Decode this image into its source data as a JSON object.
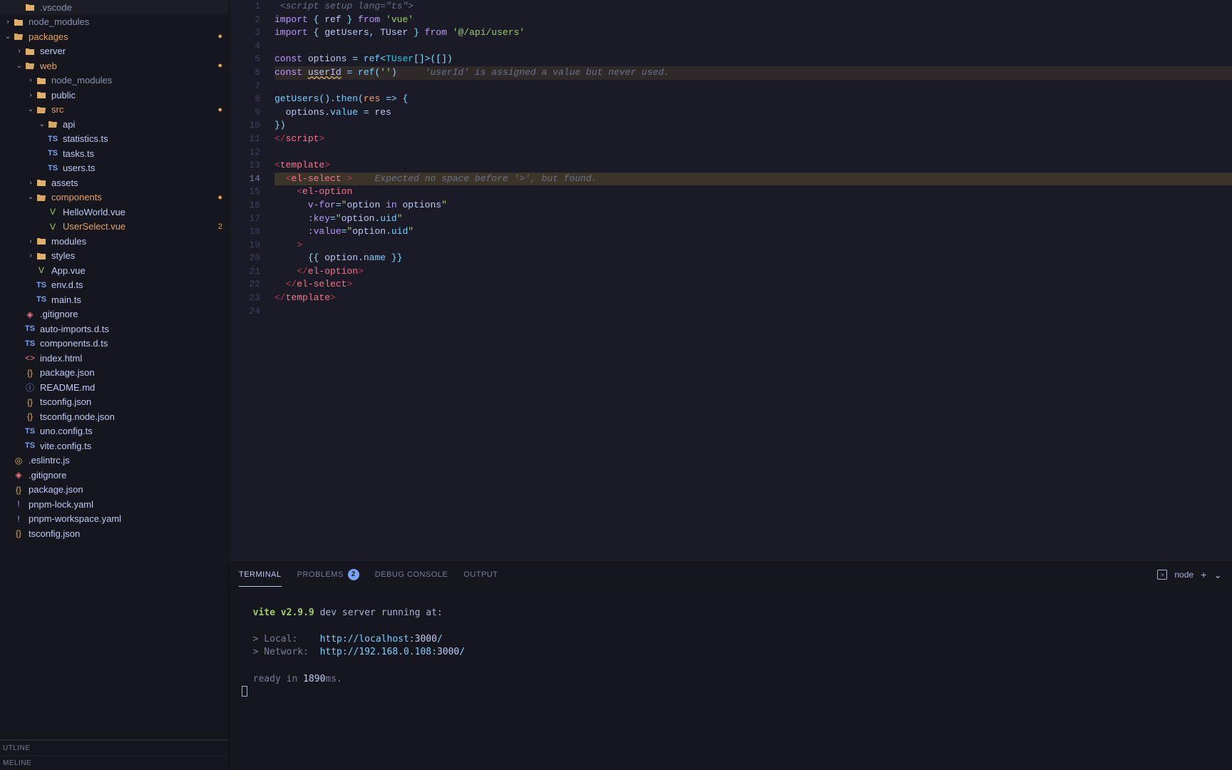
{
  "sidebar": {
    "items": [
      {
        "indent": 1,
        "twisty": "",
        "icon": "folder",
        "iconClass": "ic-folder",
        "label": ".vscode",
        "style": "dim"
      },
      {
        "indent": 0,
        "twisty": ">",
        "icon": "folder",
        "iconClass": "ic-folder",
        "label": "node_modules",
        "style": "dim"
      },
      {
        "indent": 0,
        "twisty": "v",
        "icon": "folder-open",
        "iconClass": "ic-folder-open",
        "label": "packages",
        "style": "highlight",
        "badge": "dot"
      },
      {
        "indent": 1,
        "twisty": ">",
        "icon": "folder",
        "iconClass": "ic-folder",
        "label": "server"
      },
      {
        "indent": 1,
        "twisty": "v",
        "icon": "folder-open",
        "iconClass": "ic-folder-open",
        "label": "web",
        "style": "highlight",
        "badge": "dot"
      },
      {
        "indent": 2,
        "twisty": ">",
        "icon": "folder",
        "iconClass": "ic-folder",
        "label": "node_modules",
        "style": "dim"
      },
      {
        "indent": 2,
        "twisty": ">",
        "icon": "folder",
        "iconClass": "ic-folder",
        "label": "public"
      },
      {
        "indent": 2,
        "twisty": "v",
        "icon": "folder-open",
        "iconClass": "ic-folder-open",
        "label": "src",
        "style": "highlight",
        "badge": "dot"
      },
      {
        "indent": 3,
        "twisty": "v",
        "icon": "folder-open",
        "iconClass": "ic-folder-open",
        "label": "api"
      },
      {
        "indent": 3,
        "twisty": "",
        "icon": "TS",
        "iconClass": "ic-ts",
        "label": "statistics.ts"
      },
      {
        "indent": 3,
        "twisty": "",
        "icon": "TS",
        "iconClass": "ic-ts",
        "label": "tasks.ts"
      },
      {
        "indent": 3,
        "twisty": "",
        "icon": "TS",
        "iconClass": "ic-ts",
        "label": "users.ts"
      },
      {
        "indent": 2,
        "twisty": ">",
        "icon": "folder",
        "iconClass": "ic-folder",
        "label": "assets"
      },
      {
        "indent": 2,
        "twisty": "v",
        "icon": "folder-open",
        "iconClass": "ic-folder-open",
        "label": "components",
        "style": "highlight",
        "badge": "dot"
      },
      {
        "indent": 3,
        "twisty": "",
        "icon": "V",
        "iconClass": "ic-vue",
        "label": "HelloWorld.vue"
      },
      {
        "indent": 3,
        "twisty": "",
        "icon": "V",
        "iconClass": "ic-vue",
        "label": "UserSelect.vue",
        "style": "highlight",
        "badge": "2"
      },
      {
        "indent": 2,
        "twisty": ">",
        "icon": "folder",
        "iconClass": "ic-folder",
        "label": "modules"
      },
      {
        "indent": 2,
        "twisty": ">",
        "icon": "folder",
        "iconClass": "ic-folder",
        "label": "styles"
      },
      {
        "indent": 2,
        "twisty": "",
        "icon": "V",
        "iconClass": "ic-vue",
        "label": "App.vue"
      },
      {
        "indent": 2,
        "twisty": "",
        "icon": "TS",
        "iconClass": "ic-ts",
        "label": "env.d.ts"
      },
      {
        "indent": 2,
        "twisty": "",
        "icon": "TS",
        "iconClass": "ic-ts",
        "label": "main.ts"
      },
      {
        "indent": 1,
        "twisty": "",
        "icon": "◈",
        "iconClass": "ic-git",
        "label": ".gitignore"
      },
      {
        "indent": 1,
        "twisty": "",
        "icon": "TS",
        "iconClass": "ic-ts",
        "label": "auto-imports.d.ts"
      },
      {
        "indent": 1,
        "twisty": "",
        "icon": "TS",
        "iconClass": "ic-ts",
        "label": "components.d.ts"
      },
      {
        "indent": 1,
        "twisty": "",
        "icon": "<>",
        "iconClass": "ic-html",
        "label": "index.html"
      },
      {
        "indent": 1,
        "twisty": "",
        "icon": "{}",
        "iconClass": "ic-json",
        "label": "package.json"
      },
      {
        "indent": 1,
        "twisty": "",
        "icon": "ⓘ",
        "iconClass": "ic-md",
        "label": "README.md"
      },
      {
        "indent": 1,
        "twisty": "",
        "icon": "{}",
        "iconClass": "ic-json",
        "label": "tsconfig.json"
      },
      {
        "indent": 1,
        "twisty": "",
        "icon": "{}",
        "iconClass": "ic-json",
        "label": "tsconfig.node.json"
      },
      {
        "indent": 1,
        "twisty": "",
        "icon": "TS",
        "iconClass": "ic-ts",
        "label": "uno.config.ts"
      },
      {
        "indent": 1,
        "twisty": "",
        "icon": "TS",
        "iconClass": "ic-ts",
        "label": "vite.config.ts"
      },
      {
        "indent": 0,
        "twisty": "",
        "icon": "◎",
        "iconClass": "ic-js",
        "label": ".eslintrc.js"
      },
      {
        "indent": 0,
        "twisty": "",
        "icon": "◈",
        "iconClass": "ic-git",
        "label": ".gitignore"
      },
      {
        "indent": 0,
        "twisty": "",
        "icon": "{}",
        "iconClass": "ic-json",
        "label": "package.json"
      },
      {
        "indent": 0,
        "twisty": "",
        "icon": "!",
        "iconClass": "ic-yaml",
        "label": "pnpm-lock.yaml"
      },
      {
        "indent": 0,
        "twisty": "",
        "icon": "!",
        "iconClass": "ic-yaml",
        "label": "pnpm-workspace.yaml"
      },
      {
        "indent": 0,
        "twisty": "",
        "icon": "{}",
        "iconClass": "ic-json",
        "label": "tsconfig.json"
      }
    ],
    "sections": {
      "outline": "UTLINE",
      "timeline": "MELINE"
    }
  },
  "editor": {
    "lineCount": 24,
    "activeLine": 14,
    "tokens": [
      [
        {
          "t": " ",
          "c": "punc"
        },
        {
          "t": "<script setup lang=\"ts\">",
          "c": "err"
        }
      ],
      [
        {
          "t": "import ",
          "c": "kw"
        },
        {
          "t": "{ ",
          "c": "punc"
        },
        {
          "t": "ref",
          "c": "var"
        },
        {
          "t": " } ",
          "c": "punc"
        },
        {
          "t": "from ",
          "c": "kw"
        },
        {
          "t": "'vue'",
          "c": "str"
        }
      ],
      [
        {
          "t": "import ",
          "c": "kw"
        },
        {
          "t": "{ ",
          "c": "punc"
        },
        {
          "t": "getUsers",
          "c": "var"
        },
        {
          "t": ", ",
          "c": "punc"
        },
        {
          "t": "TUser",
          "c": "var"
        },
        {
          "t": " } ",
          "c": "punc"
        },
        {
          "t": "from ",
          "c": "kw"
        },
        {
          "t": "'@/api/users'",
          "c": "str"
        }
      ],
      [],
      [
        {
          "t": "const ",
          "c": "kw"
        },
        {
          "t": "options",
          "c": "var"
        },
        {
          "t": " = ",
          "c": "op"
        },
        {
          "t": "ref",
          "c": "fn"
        },
        {
          "t": "<",
          "c": "punc"
        },
        {
          "t": "TUser",
          "c": "type"
        },
        {
          "t": "[]>",
          "c": "punc"
        },
        {
          "t": "([])",
          "c": "punc"
        }
      ],
      [
        {
          "t": "const ",
          "c": "kw"
        },
        {
          "t": "userId",
          "c": "var wavy"
        },
        {
          "t": " = ",
          "c": "op"
        },
        {
          "t": "ref",
          "c": "fn"
        },
        {
          "t": "(",
          "c": "punc"
        },
        {
          "t": "''",
          "c": "str"
        },
        {
          "t": ")",
          "c": "punc"
        },
        {
          "t": "     ",
          "c": ""
        },
        {
          "t": "'userId' is assigned a value but never used.",
          "c": "err"
        }
      ],
      [],
      [
        {
          "t": "getUsers",
          "c": "fn"
        },
        {
          "t": "()",
          "c": "punc"
        },
        {
          "t": ".",
          "c": "punc"
        },
        {
          "t": "then",
          "c": "fn"
        },
        {
          "t": "(",
          "c": "punc"
        },
        {
          "t": "res",
          "c": "num"
        },
        {
          "t": " => ",
          "c": "op"
        },
        {
          "t": "{",
          "c": "punc"
        }
      ],
      [
        {
          "t": "  options",
          "c": "var"
        },
        {
          "t": ".",
          "c": "punc"
        },
        {
          "t": "value",
          "c": "prop"
        },
        {
          "t": " = ",
          "c": "op"
        },
        {
          "t": "res",
          "c": "var"
        }
      ],
      [
        {
          "t": "})",
          "c": "punc"
        }
      ],
      [
        {
          "t": "</",
          "c": "tagb"
        },
        {
          "t": "script",
          "c": "tag"
        },
        {
          "t": ">",
          "c": "tagb"
        }
      ],
      [],
      [
        {
          "t": "<",
          "c": "tagb"
        },
        {
          "t": "template",
          "c": "tag"
        },
        {
          "t": ">",
          "c": "tagb"
        }
      ],
      [
        {
          "t": "  ",
          "c": ""
        },
        {
          "t": "<",
          "c": "tagb"
        },
        {
          "t": "el-select",
          "c": "tag"
        },
        {
          "t": " ",
          "c": ""
        },
        {
          "t": ">",
          "c": "tagb"
        },
        {
          "t": "    ",
          "c": ""
        },
        {
          "t": "Expected no space before '>', but found.",
          "c": "err"
        }
      ],
      [
        {
          "t": "    ",
          "c": ""
        },
        {
          "t": "<",
          "c": "tagb"
        },
        {
          "t": "el-option",
          "c": "tag"
        }
      ],
      [
        {
          "t": "      ",
          "c": ""
        },
        {
          "t": "v-for",
          "c": "attr"
        },
        {
          "t": "=",
          "c": "op"
        },
        {
          "t": "\"",
          "c": "str"
        },
        {
          "t": "option ",
          "c": "var"
        },
        {
          "t": "in ",
          "c": "kw"
        },
        {
          "t": "options",
          "c": "var"
        },
        {
          "t": "\"",
          "c": "str"
        }
      ],
      [
        {
          "t": "      ",
          "c": ""
        },
        {
          "t": ":key",
          "c": "attr"
        },
        {
          "t": "=",
          "c": "op"
        },
        {
          "t": "\"",
          "c": "str"
        },
        {
          "t": "option",
          "c": "var"
        },
        {
          "t": ".",
          "c": "punc"
        },
        {
          "t": "uid",
          "c": "prop"
        },
        {
          "t": "\"",
          "c": "str"
        }
      ],
      [
        {
          "t": "      ",
          "c": ""
        },
        {
          "t": ":value",
          "c": "attr"
        },
        {
          "t": "=",
          "c": "op"
        },
        {
          "t": "\"",
          "c": "str"
        },
        {
          "t": "option",
          "c": "var"
        },
        {
          "t": ".",
          "c": "punc"
        },
        {
          "t": "uid",
          "c": "prop"
        },
        {
          "t": "\"",
          "c": "str"
        }
      ],
      [
        {
          "t": "    ",
          "c": ""
        },
        {
          "t": ">",
          "c": "tagb"
        }
      ],
      [
        {
          "t": "      ",
          "c": ""
        },
        {
          "t": "{{ ",
          "c": "punc"
        },
        {
          "t": "option",
          "c": "var"
        },
        {
          "t": ".",
          "c": "punc"
        },
        {
          "t": "name",
          "c": "prop"
        },
        {
          "t": " }}",
          "c": "punc"
        }
      ],
      [
        {
          "t": "    ",
          "c": ""
        },
        {
          "t": "</",
          "c": "tagb"
        },
        {
          "t": "el-option",
          "c": "tag"
        },
        {
          "t": ">",
          "c": "tagb"
        }
      ],
      [
        {
          "t": "  ",
          "c": ""
        },
        {
          "t": "</",
          "c": "tagb"
        },
        {
          "t": "el-select",
          "c": "tag"
        },
        {
          "t": ">",
          "c": "tagb"
        }
      ],
      [
        {
          "t": "</",
          "c": "tagb"
        },
        {
          "t": "template",
          "c": "tag"
        },
        {
          "t": ">",
          "c": "tagb"
        }
      ],
      []
    ],
    "lineClasses": {
      "6": "warn",
      "14": "highlight"
    }
  },
  "panel": {
    "tabs": {
      "terminal": "TERMINAL",
      "problems": "PROBLEMS",
      "problemsCount": "2",
      "debug": "DEBUG CONSOLE",
      "output": "OUTPUT"
    },
    "shell": "node",
    "terminal": {
      "l1a": "vite v2.9.9",
      "l1b": " dev server running at:",
      "l2a": "> Local:    ",
      "l2b": "http://localhost:",
      "l2c": "3000",
      "l2d": "/",
      "l3a": "> Network:  ",
      "l3b": "http://192.168.0.108:",
      "l3c": "3000",
      "l3d": "/",
      "l4a": "ready in ",
      "l4b": "1890",
      "l4c": "ms."
    }
  }
}
